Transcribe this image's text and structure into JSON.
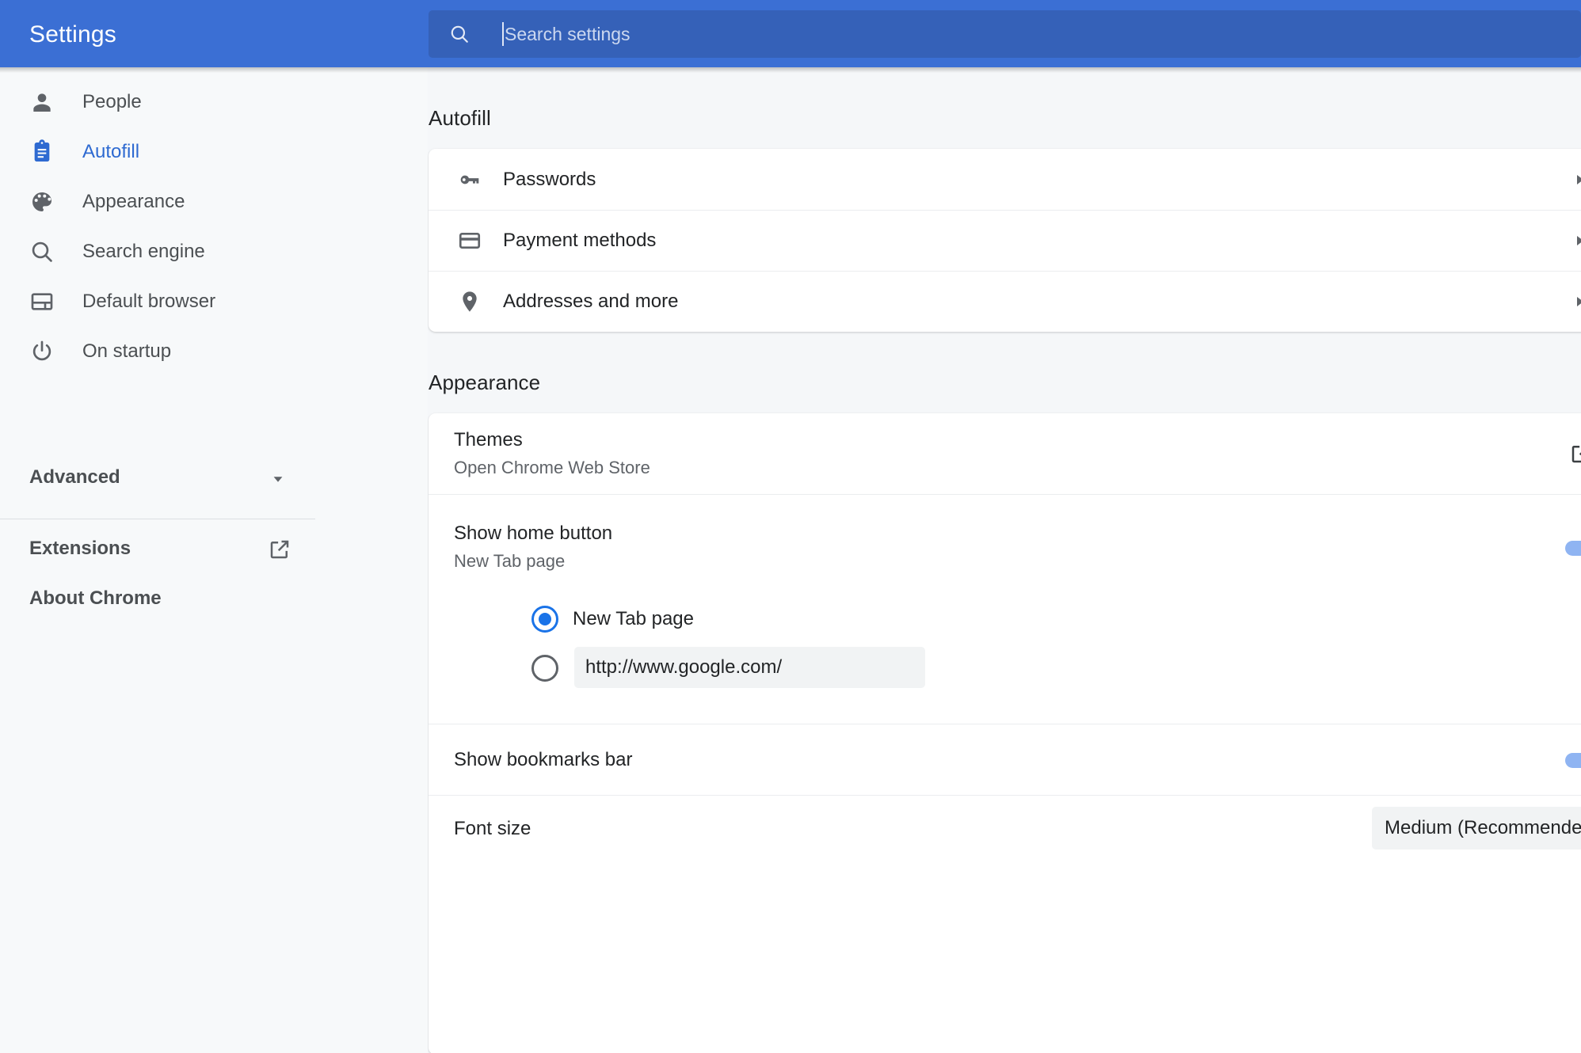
{
  "header": {
    "title": "Settings",
    "search": {
      "placeholder": "Search settings",
      "icon": "search-icon",
      "value": ""
    },
    "background_color": "#3b6fd4",
    "search_background_color": "#3561b8"
  },
  "sidebar": {
    "items": [
      {
        "label": "People",
        "icon": "person-icon",
        "selected": false
      },
      {
        "label": "Autofill",
        "icon": "clipboard-icon",
        "selected": true
      },
      {
        "label": "Appearance",
        "icon": "palette-icon",
        "selected": false
      },
      {
        "label": "Search engine",
        "icon": "search-icon",
        "selected": false
      },
      {
        "label": "Default browser",
        "icon": "browser-window-icon",
        "selected": false
      },
      {
        "label": "On startup",
        "icon": "power-icon",
        "selected": false
      }
    ],
    "advanced": {
      "label": "Advanced",
      "icon": "chevron-down-icon",
      "expanded": false
    },
    "footer_links": [
      {
        "label": "Extensions",
        "icon": "open-in-new-icon"
      },
      {
        "label": "About Chrome",
        "icon": null
      }
    ],
    "selected_accent_color": "#2e6ad1"
  },
  "main": {
    "sections": [
      {
        "title": "Autofill",
        "rows": [
          {
            "label": "Passwords",
            "icon": "key-icon",
            "arrow": "chevron-right-icon"
          },
          {
            "label": "Payment methods",
            "icon": "credit-card-icon",
            "arrow": "chevron-right-icon"
          },
          {
            "label": "Addresses and more",
            "icon": "location-pin-icon",
            "arrow": "chevron-right-icon"
          }
        ]
      },
      {
        "title": "Appearance",
        "rows": [
          {
            "label": "Themes",
            "sublabel": "Open Chrome Web Store",
            "control": "external-link",
            "control_icon": "open-in-new-icon"
          },
          {
            "label": "Show home button",
            "sublabel": "New Tab page",
            "control": "toggle",
            "toggle_on": true,
            "radios": [
              {
                "label": "New Tab page",
                "checked": true,
                "type": "label"
              },
              {
                "label": "http://www.google.com/",
                "checked": false,
                "type": "input"
              }
            ]
          },
          {
            "label": "Show bookmarks bar",
            "control": "toggle",
            "toggle_on": true
          },
          {
            "label": "Font size",
            "control": "select",
            "select_value": "Medium (Recommended)",
            "select_caret": "chevron-down-icon"
          }
        ]
      }
    ]
  },
  "colors": {
    "accent": "#1a73e8",
    "toggle_on_track": "#8fb4f2",
    "toggle_on_knob": "#1a6ae3",
    "page_background": "#f5f7f9",
    "card_background": "#ffffff",
    "text_primary": "#222426",
    "text_secondary": "#5f6368"
  }
}
